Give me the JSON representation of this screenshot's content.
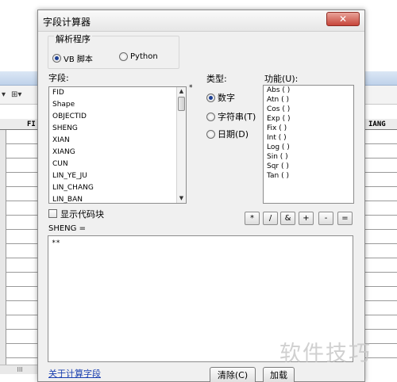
{
  "background_table": {
    "toolbar_left_symbols": [
      "▾",
      "⊞▾"
    ],
    "header_left": "FI",
    "header_right": "IANG",
    "hscroll_glyph": "III"
  },
  "dialog": {
    "title": "字段计算器",
    "close_label": "✕",
    "parser": {
      "group_title": "解析程序",
      "options": [
        {
          "label": "VB 脚本",
          "selected": true
        },
        {
          "label": "Python",
          "selected": false
        }
      ]
    },
    "fields": {
      "label": "字段:",
      "items": [
        "FID",
        "Shape",
        "OBJECTID",
        "SHENG",
        "XIAN",
        "XIANG",
        "CUN",
        "LIN_YE_JU",
        "LIN_CHANG",
        "LIN_BAN"
      ],
      "sort_marker": "*"
    },
    "type": {
      "label": "类型:",
      "options": [
        {
          "label": "数字",
          "selected": true
        },
        {
          "label": "字符串(T)",
          "selected": false
        },
        {
          "label": "日期(D)",
          "selected": false
        }
      ]
    },
    "functions": {
      "label": "功能(U):",
      "items": [
        "Abs ( )",
        "Atn ( )",
        "Cos ( )",
        "Exp ( )",
        "Fix ( )",
        "Int ( )",
        "Log ( )",
        "Sin ( )",
        "Sqr ( )",
        "Tan ( )"
      ]
    },
    "show_codeblock_label": "显示代码块",
    "operators": [
      "*",
      "/",
      "&",
      "+",
      "-",
      "="
    ],
    "expression_label": "SHENG =",
    "expression_value": "**",
    "help_link": "关于计算字段",
    "buttons": {
      "clear": "清除(C)",
      "load": "加载"
    }
  },
  "watermark": "软件技巧"
}
